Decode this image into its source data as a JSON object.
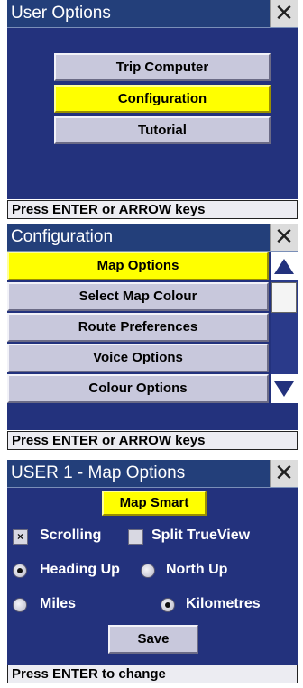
{
  "screen1": {
    "title": "User Options",
    "buttons": [
      "Trip Computer",
      "Configuration",
      "Tutorial"
    ],
    "selected_index": 1,
    "status": "Press ENTER or ARROW keys"
  },
  "screen2": {
    "title": "Configuration",
    "buttons": [
      "Map Options",
      "Select Map Colour",
      "Route Preferences",
      "Voice Options",
      "Colour Options"
    ],
    "selected_index": 0,
    "status": "Press ENTER or ARROW keys"
  },
  "screen3": {
    "title": "USER 1 - Map Options",
    "map_smart_label": "Map Smart",
    "scrolling_label": "Scrolling",
    "scrolling_checked": true,
    "split_trueview_label": "Split TrueView",
    "split_trueview_checked": false,
    "heading_up_label": "Heading Up",
    "north_up_label": "North Up",
    "orientation_selected": "Heading Up",
    "miles_label": "Miles",
    "kilometres_label": "Kilometres",
    "units_selected": "Kilometres",
    "save_label": "Save",
    "status": "Press ENTER to change"
  },
  "colors": {
    "title_bar": "#233f7a",
    "panel": "#23327d",
    "button": "#c8c8dc",
    "selected": "#ffff00"
  },
  "icons": [
    "close-icon",
    "scroll-up-icon",
    "scroll-down-icon",
    "checkbox-icon",
    "radio-icon"
  ]
}
